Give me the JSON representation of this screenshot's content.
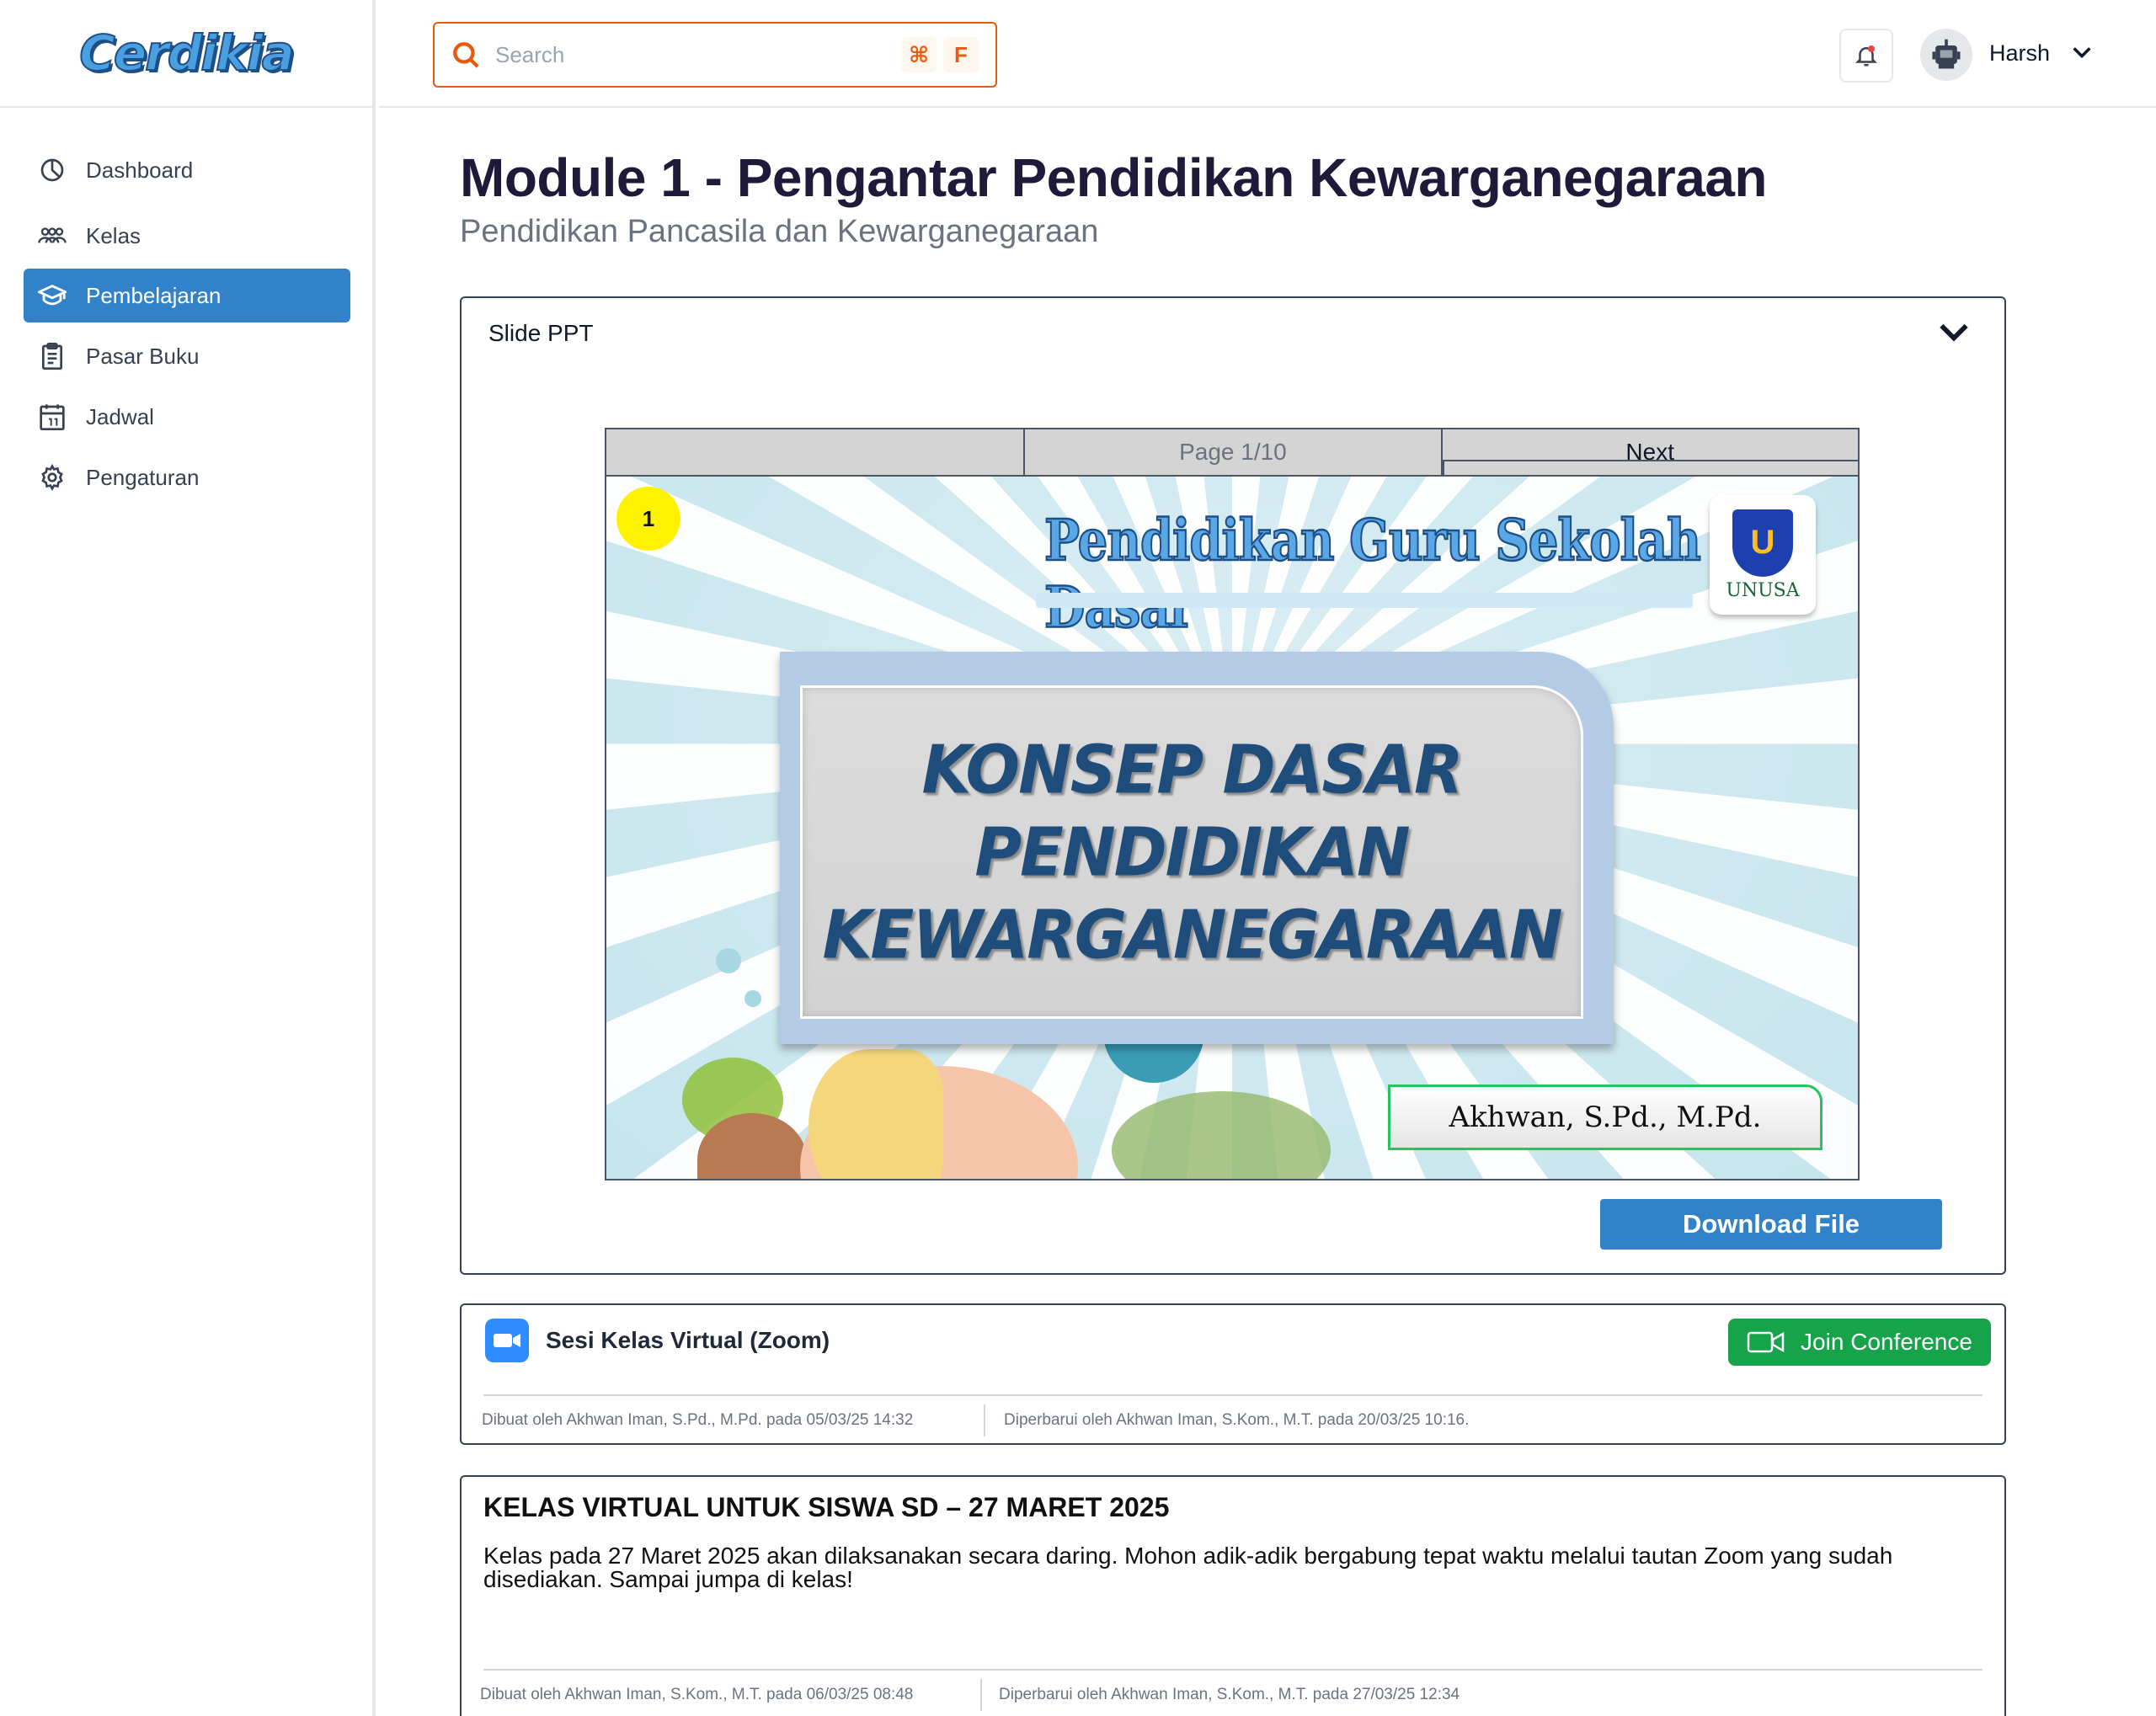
{
  "app": {
    "logo_text": "Cerdikia"
  },
  "sidebar": {
    "items": [
      {
        "label": "Dashboard",
        "icon": "dashboard-icon",
        "active": false
      },
      {
        "label": "Kelas",
        "icon": "users-icon",
        "active": false
      },
      {
        "label": "Pembelajaran",
        "icon": "graduation-cap-icon",
        "active": true
      },
      {
        "label": "Pasar Buku",
        "icon": "clipboard-icon",
        "active": false
      },
      {
        "label": "Jadwal",
        "icon": "calendar-icon",
        "active": false
      },
      {
        "label": "Pengaturan",
        "icon": "gear-icon",
        "active": false
      }
    ]
  },
  "topbar": {
    "search": {
      "placeholder": "Search",
      "value": "",
      "shortcut_mod": "⌘",
      "shortcut_key": "F"
    },
    "user": {
      "name": "Harsh"
    }
  },
  "page": {
    "title": "Module 1 - Pengantar Pendidikan Kewarganegaraan",
    "subtitle": "Pendidikan Pancasila dan Kewarganegaraan"
  },
  "ppt_card": {
    "title": "Slide PPT",
    "viewer": {
      "page_label": "Page 1/10",
      "next_label": "Next",
      "page_current": 1,
      "page_total": 10
    },
    "slide": {
      "number": "1",
      "header": "Pendidikan Guru Sekolah Dasar",
      "logo_text": "UNUSA",
      "title_lines": [
        "KONSEP DASAR",
        "PENDIDIKAN",
        "KEWARGANEGARAAN"
      ],
      "author": "Akhwan, S.Pd., M.Pd."
    },
    "download_label": "Download File"
  },
  "zoom_card": {
    "title": "Sesi Kelas Virtual (Zoom)",
    "join_label": "Join Conference",
    "created": "Dibuat oleh Akhwan Iman, S.Pd., M.Pd. pada 05/03/25 14:32",
    "updated": "Diperbarui oleh Akhwan Iman, S.Kom., M.T. pada 20/03/25 10:16."
  },
  "announcement_card": {
    "title": "KELAS VIRTUAL UNTUK SISWA SD – 27 MARET 2025",
    "body": "Kelas pada 27 Maret 2025 akan dilaksanakan secara daring. Mohon adik-adik bergabung tepat waktu melalui tautan Zoom yang sudah disediakan. Sampai jumpa di kelas!",
    "created": "Dibuat oleh Akhwan Iman, S.Kom., M.T. pada 06/03/25 08:48",
    "updated": "Diperbarui oleh Akhwan Iman, S.Kom., M.T. pada 27/03/25 12:34"
  },
  "colors": {
    "primary": "#3182c8",
    "accent_orange": "#ea580c",
    "success": "#16a34a",
    "zoom_blue": "#2d8cff",
    "title_dark": "#1e1b3a"
  }
}
